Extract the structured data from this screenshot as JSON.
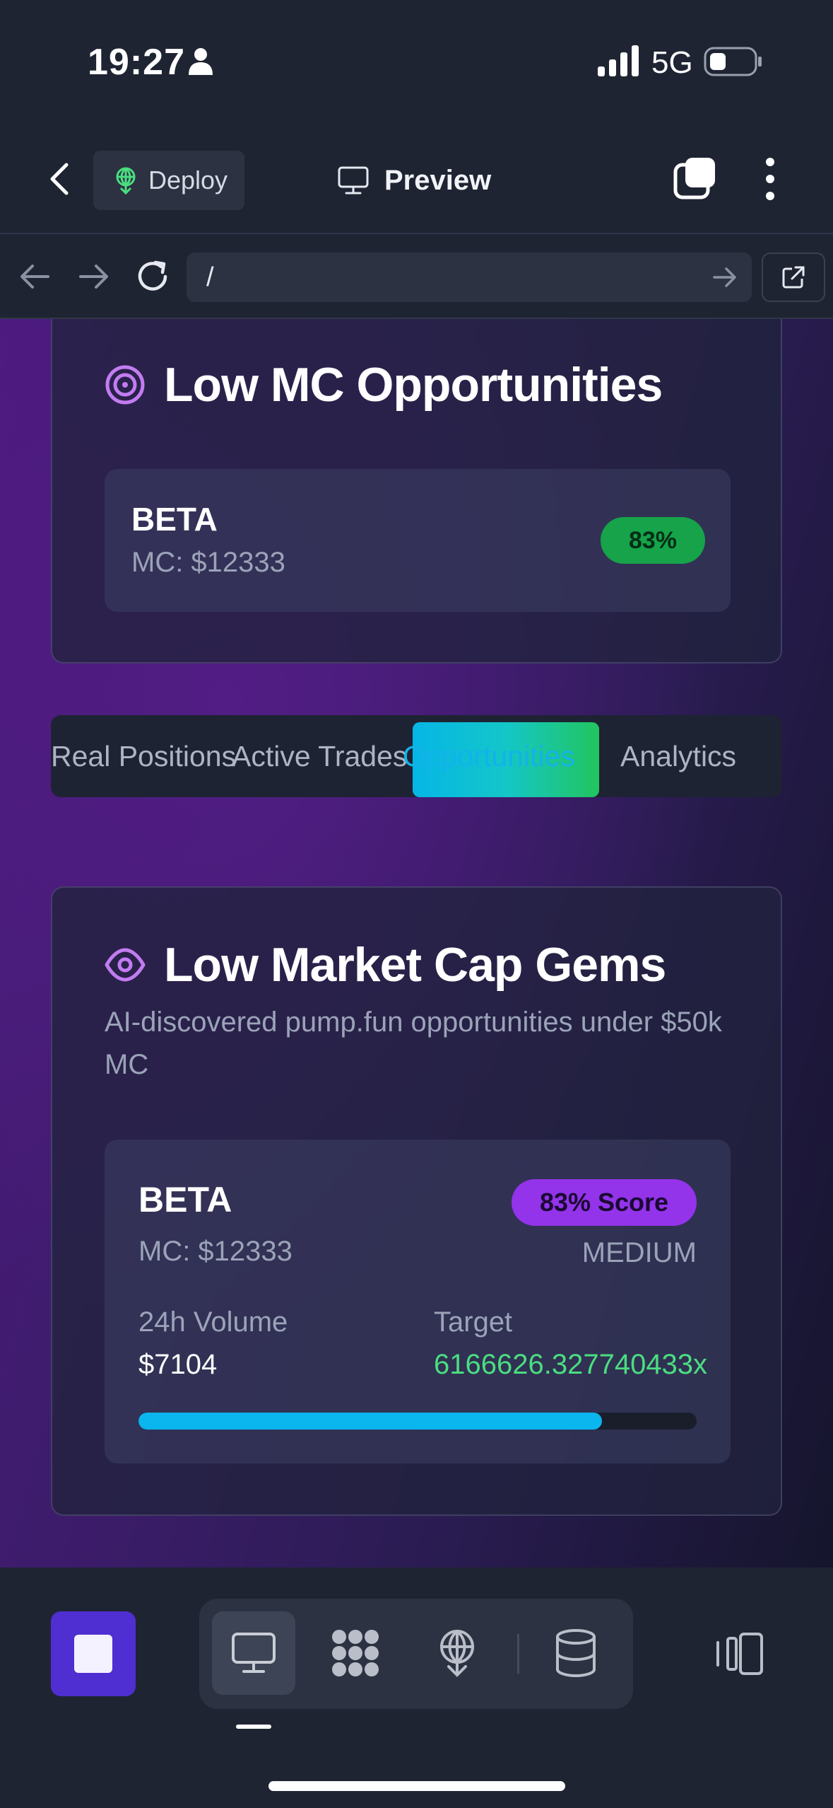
{
  "status_bar": {
    "time": "19:27",
    "network": "5G",
    "icons": [
      "person-icon",
      "signal-icon",
      "battery-icon"
    ]
  },
  "toolbar": {
    "deploy_label": "Deploy",
    "preview_label": "Preview",
    "icons": [
      "back-icon",
      "deploy-icon",
      "monitor-icon",
      "tabs-icon",
      "more-icon"
    ]
  },
  "urlbar": {
    "url": "/",
    "icons": [
      "arrow-left-icon",
      "arrow-right-icon",
      "reload-icon",
      "go-arrow-icon",
      "external-link-icon"
    ]
  },
  "low_mc": {
    "title": "Low MC Opportunities",
    "icon": "target-icon",
    "token": {
      "name": "BETA",
      "mc": "MC: $12333",
      "percent": "83%"
    }
  },
  "tabs": [
    {
      "label": "Real Positions",
      "active": false
    },
    {
      "label": "Active Trades",
      "active": false
    },
    {
      "label": "Opportunities",
      "active": true
    },
    {
      "label": "Analytics",
      "active": false
    }
  ],
  "gems": {
    "title": "Low Market Cap Gems",
    "icon": "eye-icon",
    "description": "AI-discovered pump.fun opportunities under $50k MC",
    "token": {
      "name": "BETA",
      "mc": "MC: $12333",
      "score": "83% Score",
      "risk": "MEDIUM",
      "volume_label": "24h Volume",
      "volume_value": "$7104",
      "target_label": "Target",
      "target_value": "6166626.327740433x",
      "progress": 0.83
    }
  },
  "bottom_bar": {
    "tools": [
      "monitor-icon",
      "nodes-icon",
      "deploy-icon",
      "database-icon"
    ],
    "right_icon": "panels-icon"
  },
  "colors": {
    "accent": "#4f2fd1",
    "tab_gradient_start": "#06b6e6",
    "tab_gradient_end": "#22c55e",
    "score_purple": "#9333ea",
    "badge_green": "#16a34a",
    "target_green": "#4ade80",
    "progress": "#0bb5ee"
  }
}
